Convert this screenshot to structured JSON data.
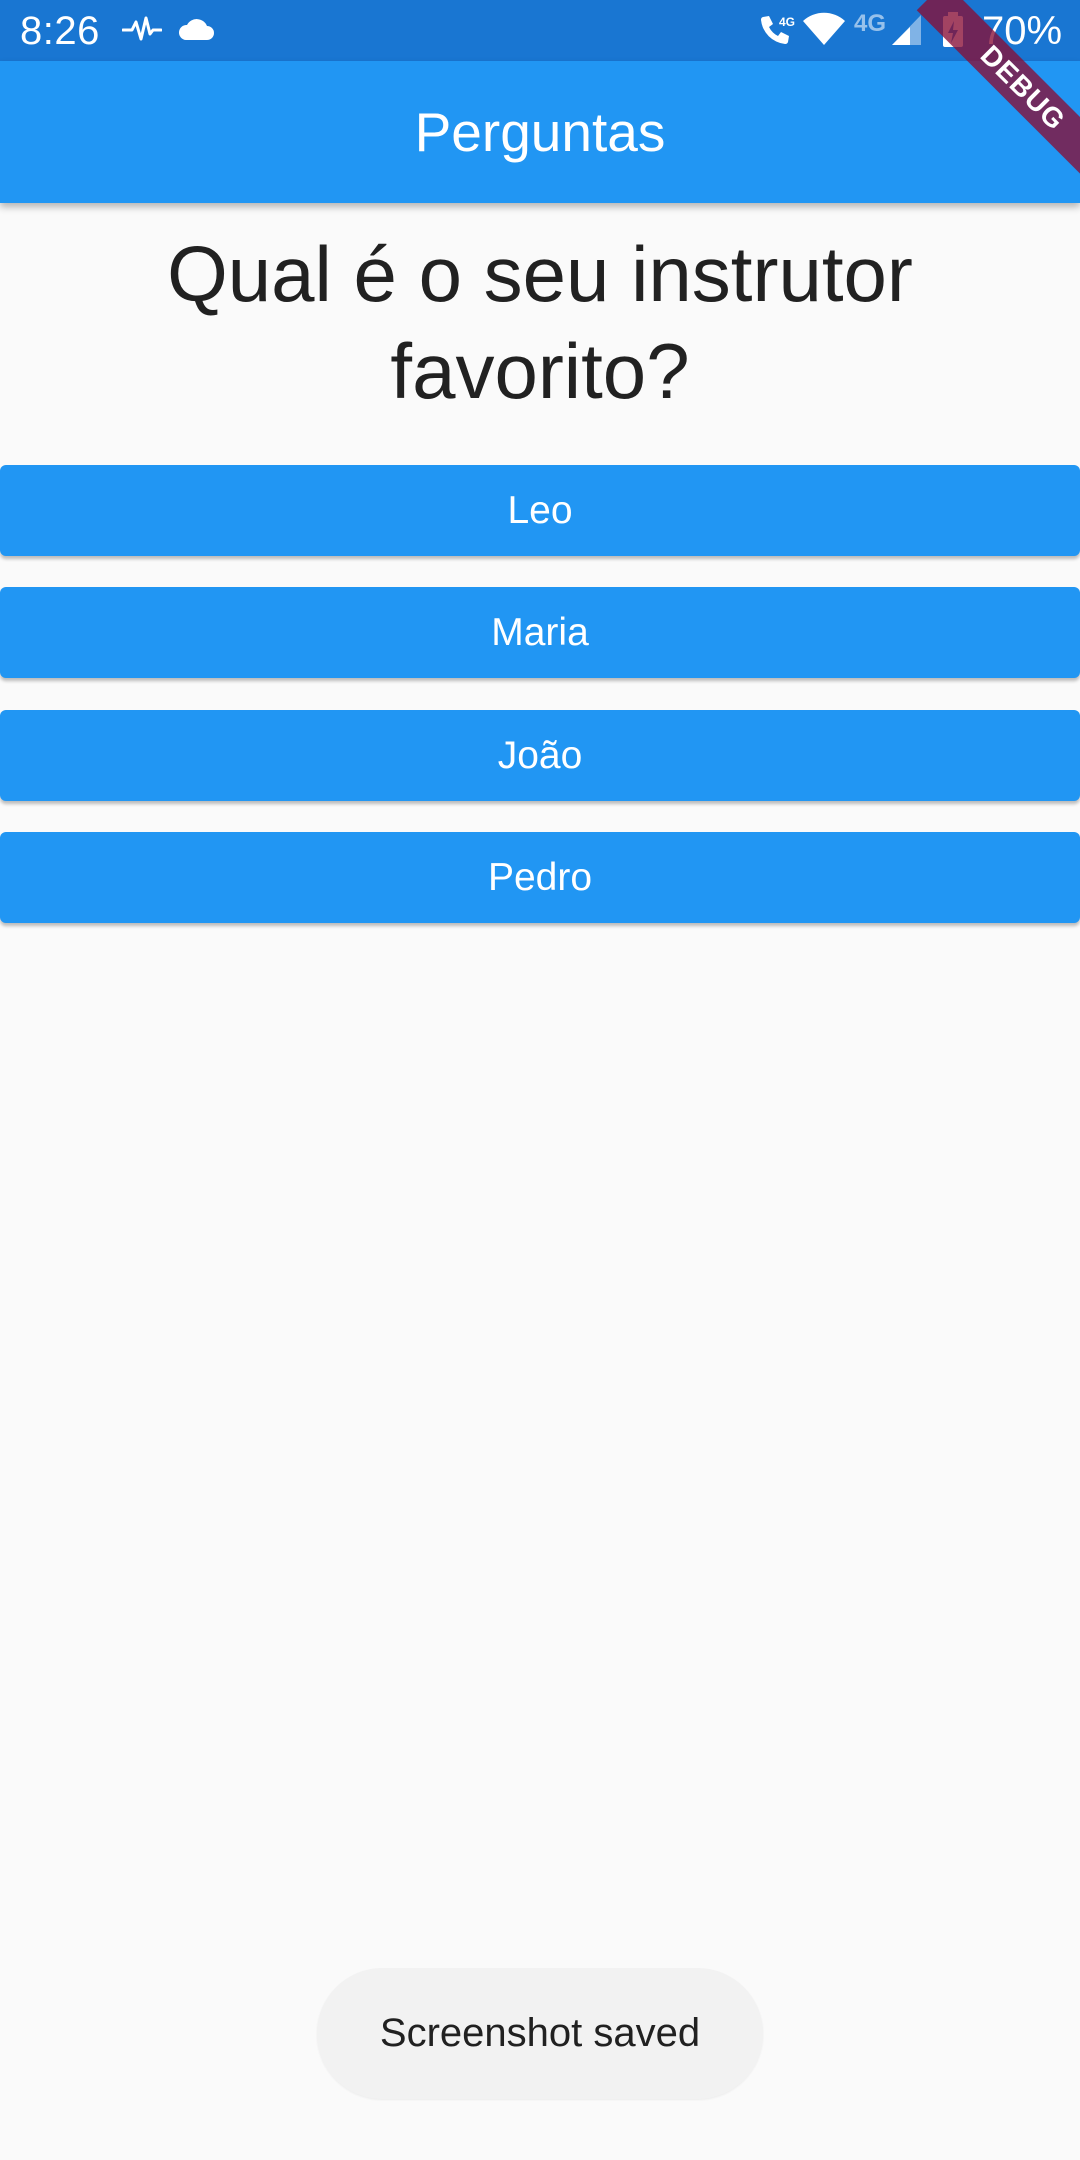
{
  "status_bar": {
    "time": "8:26",
    "network_label": "4G",
    "battery": "70%",
    "icons": [
      "activity-icon",
      "cloud-icon",
      "wifi-calling-icon",
      "wifi-icon",
      "signal-icon",
      "battery-charging-icon"
    ]
  },
  "debug_banner": "DEBUG",
  "app_bar": {
    "title": "Perguntas"
  },
  "question": "Qual é o seu instrutor favorito?",
  "answers": [
    {
      "label": "Leo"
    },
    {
      "label": "Maria"
    },
    {
      "label": "João"
    },
    {
      "label": "Pedro"
    }
  ],
  "toast": "Screenshot saved",
  "colors": {
    "status_bar": "#1976d2",
    "primary": "#2196f3",
    "background": "#fafafa",
    "text": "#212121",
    "debug_banner": "#880e36"
  }
}
